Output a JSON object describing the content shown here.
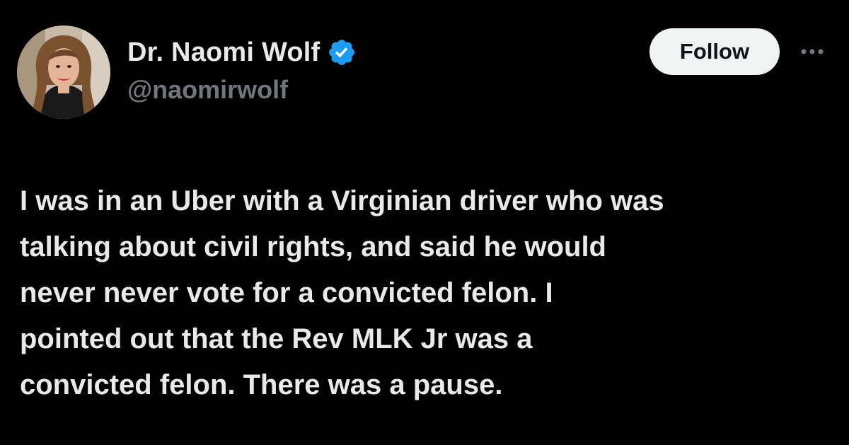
{
  "author": {
    "display_name": "Dr. Naomi Wolf",
    "handle": "@naomirwolf",
    "verified": true,
    "avatar_icon": "profile-photo"
  },
  "actions": {
    "follow_label": "Follow",
    "more_icon": "more-horizontal-icon"
  },
  "tweet": {
    "lines": [
      "I was in an Uber with a Virginian driver who was",
      "talking about civil rights, and said he would",
      "never never vote for a convicted felon. I",
      "pointed out that the Rev MLK Jr was a",
      "convicted felon. There was a pause."
    ]
  },
  "colors": {
    "background": "#000000",
    "primary_text": "#e7e9ea",
    "secondary_text": "#71767b",
    "verified_badge": "#1d9bf0",
    "follow_button_bg": "#eff3f4",
    "follow_button_text": "#0f1419"
  }
}
